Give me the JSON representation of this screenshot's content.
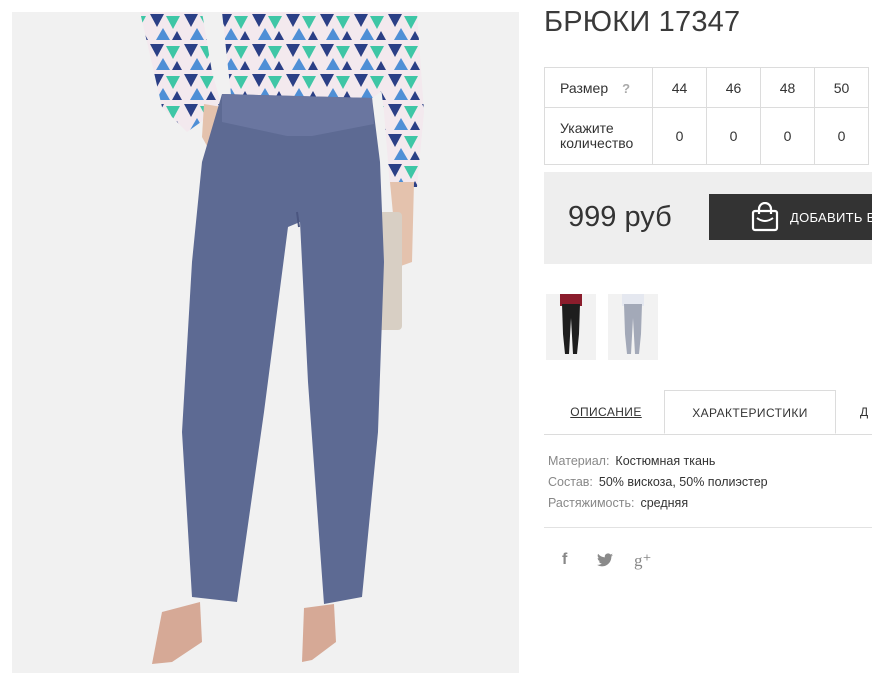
{
  "product": {
    "title": "БРЮКИ 17347"
  },
  "sizes": {
    "size_label": "Размер",
    "help_icon": "?",
    "qty_label": "Укажите количество",
    "values": [
      "44",
      "46",
      "48",
      "50"
    ],
    "quantities": [
      "0",
      "0",
      "0",
      "0"
    ]
  },
  "purchase": {
    "price": "999 руб",
    "add_to_cart": "ДОБАВИТЬ В",
    "button_color": "#333333"
  },
  "thumbnails": [
    {
      "alt": "black-trousers-thumbnail"
    },
    {
      "alt": "grey-trousers-thumbnail"
    }
  ],
  "tabs": {
    "description": "ОПИСАНИЕ",
    "characteristics": "ХАРАКТЕРИСТИКИ",
    "more": "Д"
  },
  "characteristics": [
    {
      "key": "Материал:",
      "value": "Костюмная ткань"
    },
    {
      "key": "Состав:",
      "value": "50% вискоза, 50% полиэстер"
    },
    {
      "key": "Растяжимость:",
      "value": "средняя"
    }
  ],
  "share": {
    "facebook": "f",
    "twitter_icon": "twitter-icon",
    "googleplus": "g⁺"
  }
}
